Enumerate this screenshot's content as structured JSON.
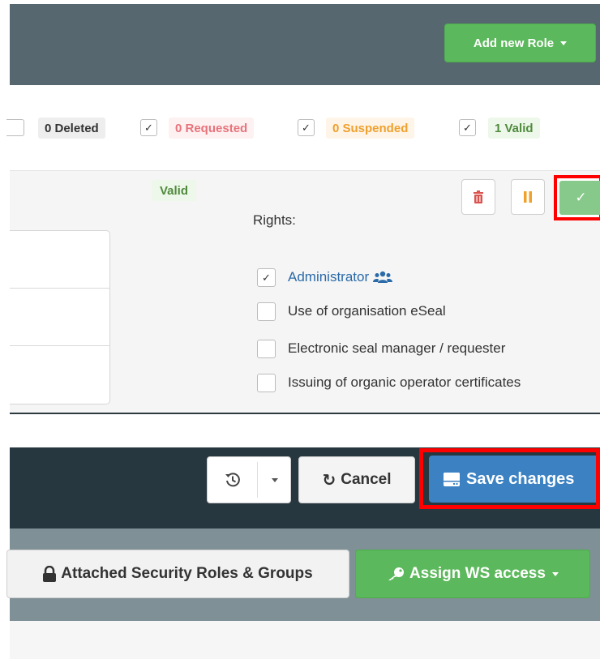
{
  "panel_a": {
    "add_role_label": "Add new Role",
    "filters": [
      {
        "label": "0 Deleted",
        "checked": false,
        "color": "#333333",
        "bg": "#eeeeee"
      },
      {
        "label": "0 Requested",
        "checked": true,
        "color": "#e8737b",
        "bg": "#fdf1f2"
      },
      {
        "label": "0 Suspended",
        "checked": true,
        "color": "#f0a02d",
        "bg": "#fef5e8"
      },
      {
        "label": "1 Valid",
        "checked": true,
        "color": "#4f8a3d",
        "bg": "#eef8ea"
      }
    ],
    "status": "Valid",
    "rights_label": "Rights:",
    "rights": [
      {
        "label": "Administrator",
        "checked": true,
        "icon": "users-icon"
      },
      {
        "label": "Use of organisation eSeal",
        "checked": false
      },
      {
        "label": "Electronic seal manager / requester",
        "checked": false
      },
      {
        "label": "Issuing of organic operator certificates",
        "checked": false
      }
    ],
    "action_icons": [
      "trash-icon",
      "pause-icon",
      "check-icon"
    ]
  },
  "panel_b": {
    "history_icon": "history-icon",
    "cancel_label": "Cancel",
    "save_label": "Save changes",
    "roles_label": "Attached Security Roles & Groups",
    "ws_label": "Assign WS access"
  },
  "colors": {
    "green": "#5cb85c",
    "blue": "#3c82c3",
    "highlight": "#ff0000",
    "dark_toolbar": "#27373f"
  }
}
